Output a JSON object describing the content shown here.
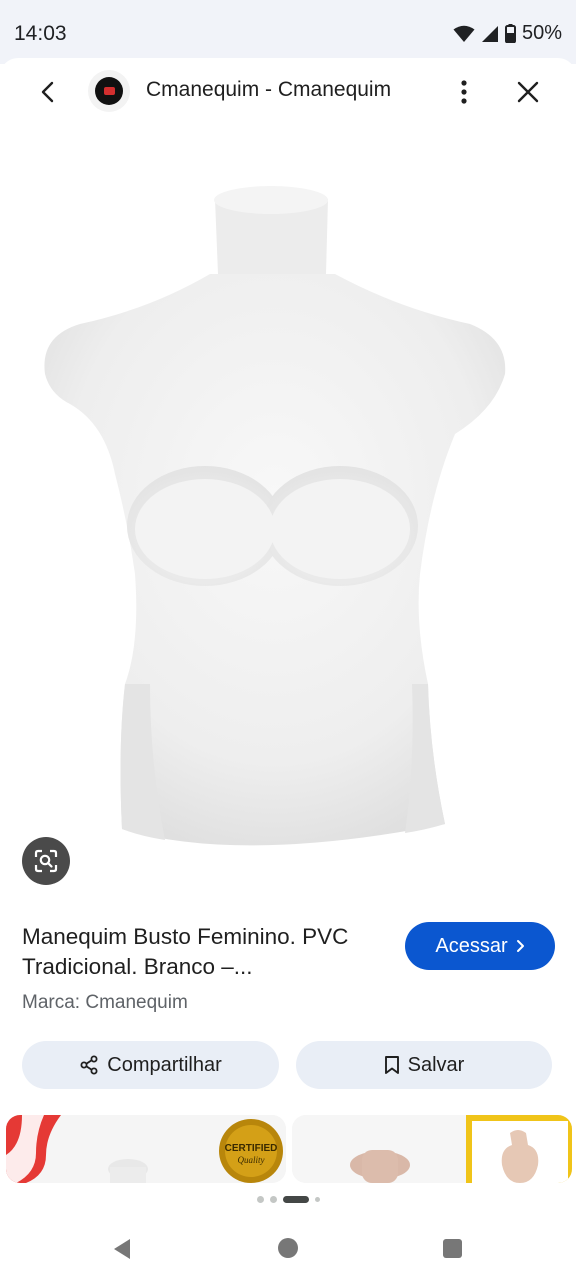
{
  "status_bar": {
    "time": "14:03",
    "battery": "50%",
    "icons": [
      "wifi-icon",
      "signal-icon",
      "battery-icon"
    ]
  },
  "app_bar": {
    "site_title": "Cmanequim - Cmanequim",
    "icons": [
      "back-icon",
      "site-logo",
      "more-vert-icon",
      "close-icon"
    ]
  },
  "product": {
    "title": "Manequim Busto Feminino. PVC Tradicional. Branco –...",
    "brand": "Marca: Cmanequim",
    "visit_label": "Acessar",
    "visit_icon": "chevron-right-icon"
  },
  "actions": {
    "share_label": "Compartilhar",
    "save_label": "Salvar"
  },
  "related": {
    "badge_text_1": "CERTIFIED",
    "badge_text_2": "Quality"
  },
  "pager": {
    "total": 4,
    "active_index": 2
  },
  "colors": {
    "accent": "#0b57d0",
    "chip_bg": "#e9eef6",
    "status_bg": "#f1f3f9"
  }
}
